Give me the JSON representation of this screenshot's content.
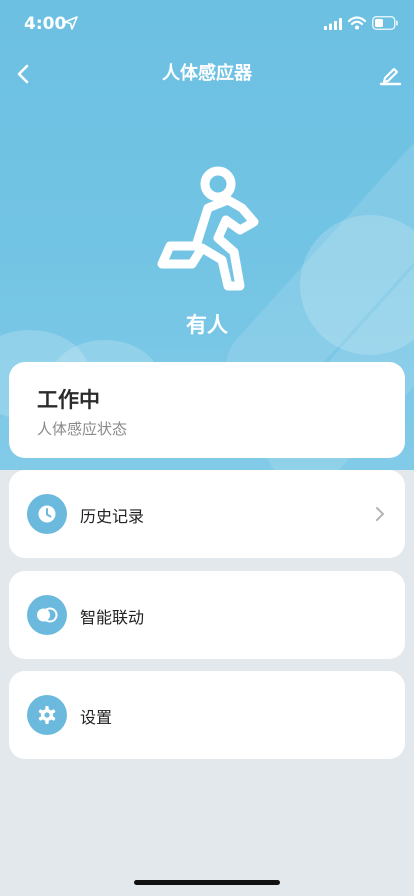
{
  "status_bar": {
    "time": "4:00"
  },
  "nav": {
    "title": "人体感应器"
  },
  "hero": {
    "presence_text": "有人"
  },
  "status_card": {
    "title": "工作中",
    "subtitle": "人体感应状态"
  },
  "menu": [
    {
      "label": "历史记录",
      "icon": "clock-icon",
      "has_chevron": true
    },
    {
      "label": "智能联动",
      "icon": "toggle-icon",
      "has_chevron": false
    },
    {
      "label": "设置",
      "icon": "gear-icon",
      "has_chevron": false
    }
  ],
  "colors": {
    "hero_bg": "#73c4e4",
    "icon_bg": "#6bbadd",
    "page_bg": "#e3e8ec"
  }
}
